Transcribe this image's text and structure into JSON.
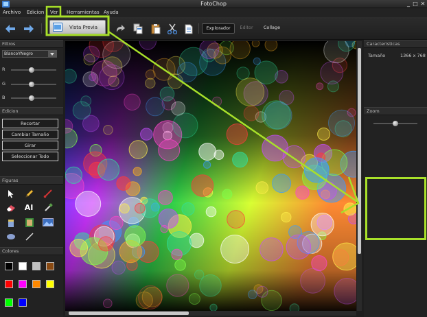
{
  "window": {
    "title": "FotoChop",
    "minimize": "_",
    "maximize": "□",
    "close": "✕"
  },
  "menu": {
    "items": [
      "Archivo",
      "Edicion",
      "Ver",
      "Herramientas",
      "Ayuda"
    ]
  },
  "toolbar": {
    "preview_label": "Vista Previa",
    "explorer_label": "Explorador",
    "editor_label": "Editor",
    "collage_label": "Collage"
  },
  "left_panel": {
    "filters_title": "Filtros",
    "filter_selected": "BlancoYNegro",
    "rgb_labels": [
      "R",
      "G",
      "B"
    ],
    "rgb_values": [
      0.45,
      0.45,
      0.45
    ],
    "edit_title": "Edicion",
    "edit_buttons": [
      "Recortar",
      "Cambiar Tamaño",
      "Girar",
      "Seleccionar Todo"
    ],
    "figures_title": "Figuras",
    "tools": [
      "arrow-icon",
      "pencil-icon",
      "brush-icon",
      "eraser-icon",
      "text-icon",
      "eyedropper-icon",
      "bucket-icon",
      "frame-icon",
      "image-icon",
      "ellipse-icon",
      "line-icon"
    ],
    "text_tool_label": "AI",
    "colors_title": "Colores",
    "colors": [
      "#000000",
      "#ffffff",
      "#c0c0c0",
      "#8a4a12",
      "#ff0000",
      "#ff00ff",
      "#ff8800",
      "#ffff00",
      "#00ff00",
      "#0000ff"
    ]
  },
  "right_panel": {
    "features_title": "Caracteristicas",
    "size_label": "Tamaño",
    "size_value": "1366 x 768",
    "zoom_title": "Zoom",
    "zoom_value": 0.5
  },
  "colors": {
    "highlight": "#a8e02a"
  }
}
